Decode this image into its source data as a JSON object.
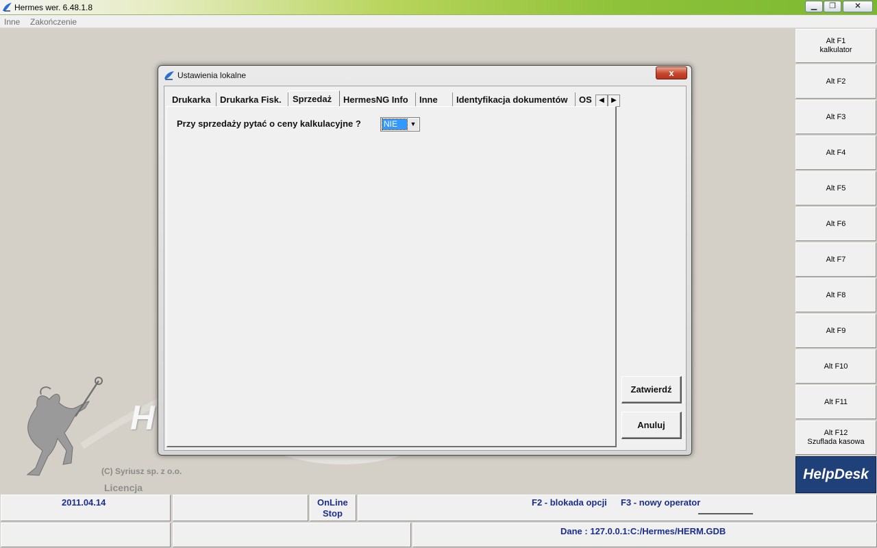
{
  "app": {
    "title": "Hermes wer. 6.48.1.8"
  },
  "window_buttons": {
    "minimize": "▁",
    "maximize": "❐",
    "close": "✕"
  },
  "menu": {
    "items": [
      "Inne",
      "Zakończenie"
    ]
  },
  "background": {
    "logo_text": "H",
    "copyright": "(C) Syriusz sp. z o.o.",
    "licencja": "Licencja"
  },
  "fkeys": [
    {
      "key": "Alt F1",
      "label": "kalkulator"
    },
    {
      "key": "Alt F2",
      "label": ""
    },
    {
      "key": "Alt F3",
      "label": ""
    },
    {
      "key": "Alt F4",
      "label": ""
    },
    {
      "key": "Alt F5",
      "label": ""
    },
    {
      "key": "Alt F6",
      "label": ""
    },
    {
      "key": "Alt F7",
      "label": ""
    },
    {
      "key": "Alt F8",
      "label": ""
    },
    {
      "key": "Alt F9",
      "label": ""
    },
    {
      "key": "Alt F10",
      "label": ""
    },
    {
      "key": "Alt F11",
      "label": ""
    },
    {
      "key": "Alt F12",
      "label": "Szuflada kasowa"
    }
  ],
  "helpdesk": "HelpDesk",
  "status": {
    "date": "2011.04.14",
    "online_line1": "OnLine",
    "online_line2": "Stop",
    "f2": "F2 - blokada opcji",
    "f3": "F3 - nowy operator",
    "dane": "Dane  : 127.0.0.1:C:/Hermes/HERM.GDB"
  },
  "dialog": {
    "title": "Ustawienia lokalne",
    "close": "x",
    "tabs": [
      "Drukarka",
      "Drukarka Fisk.",
      "Sprzedaż",
      "HermesNG Info",
      "Inne",
      "Identyfikacja dokumentów",
      "OS"
    ],
    "active_tab": "Sprzedaż",
    "tab_arrows": {
      "left": "◀",
      "right": "▶"
    },
    "field_label": "Przy sprzedaży pytać o ceny kalkulacyjne ?",
    "field_value": "NIE",
    "select_arrow": "▼",
    "buttons": {
      "ok": "Zatwierdź",
      "cancel": "Anuluj"
    }
  }
}
